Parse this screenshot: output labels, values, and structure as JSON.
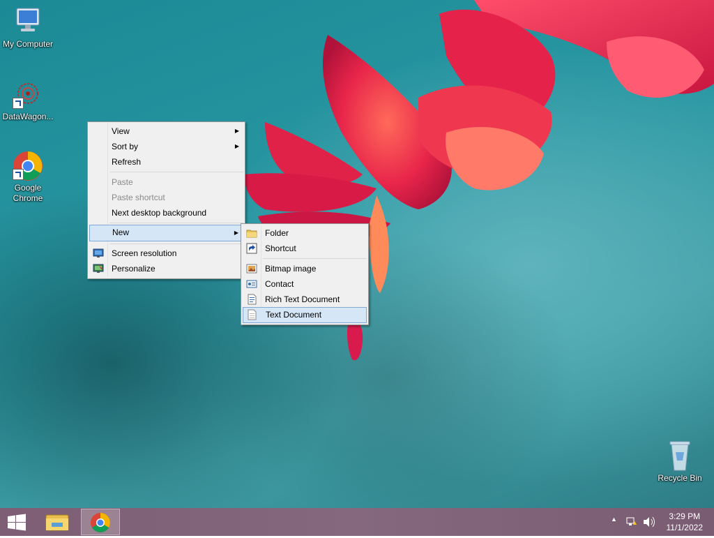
{
  "desktop": {
    "icons": [
      {
        "label": "My Computer"
      },
      {
        "label": "DataWagon..."
      },
      {
        "label": "Google\nChrome",
        "line1": "Google",
        "line2": "Chrome"
      },
      {
        "label": "Recycle Bin"
      }
    ]
  },
  "context_menu": {
    "items": [
      {
        "label": "View",
        "submenu": true
      },
      {
        "label": "Sort by",
        "submenu": true
      },
      {
        "label": "Refresh"
      },
      {
        "label": "Paste",
        "disabled": true
      },
      {
        "label": "Paste shortcut",
        "disabled": true
      },
      {
        "label": "Next desktop background"
      },
      {
        "label": "New",
        "submenu": true,
        "highlighted": true
      },
      {
        "label": "Screen resolution",
        "icon": "screen-resolution-icon"
      },
      {
        "label": "Personalize",
        "icon": "personalize-icon"
      }
    ]
  },
  "new_submenu": {
    "items": [
      {
        "label": "Folder",
        "icon": "folder-icon"
      },
      {
        "label": "Shortcut",
        "icon": "shortcut-icon"
      },
      {
        "label": "Bitmap image",
        "icon": "bitmap-image-icon"
      },
      {
        "label": "Contact",
        "icon": "contact-icon"
      },
      {
        "label": "Rich Text Document",
        "icon": "rich-text-document-icon"
      },
      {
        "label": "Text Document",
        "icon": "text-document-icon",
        "highlighted": true
      }
    ]
  },
  "taskbar": {
    "buttons": [
      {
        "name": "start",
        "icon": "windows-logo-icon"
      },
      {
        "name": "file-explorer",
        "icon": "file-explorer-icon"
      },
      {
        "name": "chrome",
        "icon": "chrome-icon",
        "active": true
      }
    ],
    "tray": {
      "icons": [
        "show-hidden-icons-chevron-icon",
        "network-icon",
        "volume-icon"
      ],
      "time": "3:29 PM",
      "date": "11/1/2022"
    }
  },
  "colors": {
    "accent_highlight": "#d5e6f7",
    "taskbar": "#7d5e74",
    "desktop_teal": "#2a98a3"
  }
}
